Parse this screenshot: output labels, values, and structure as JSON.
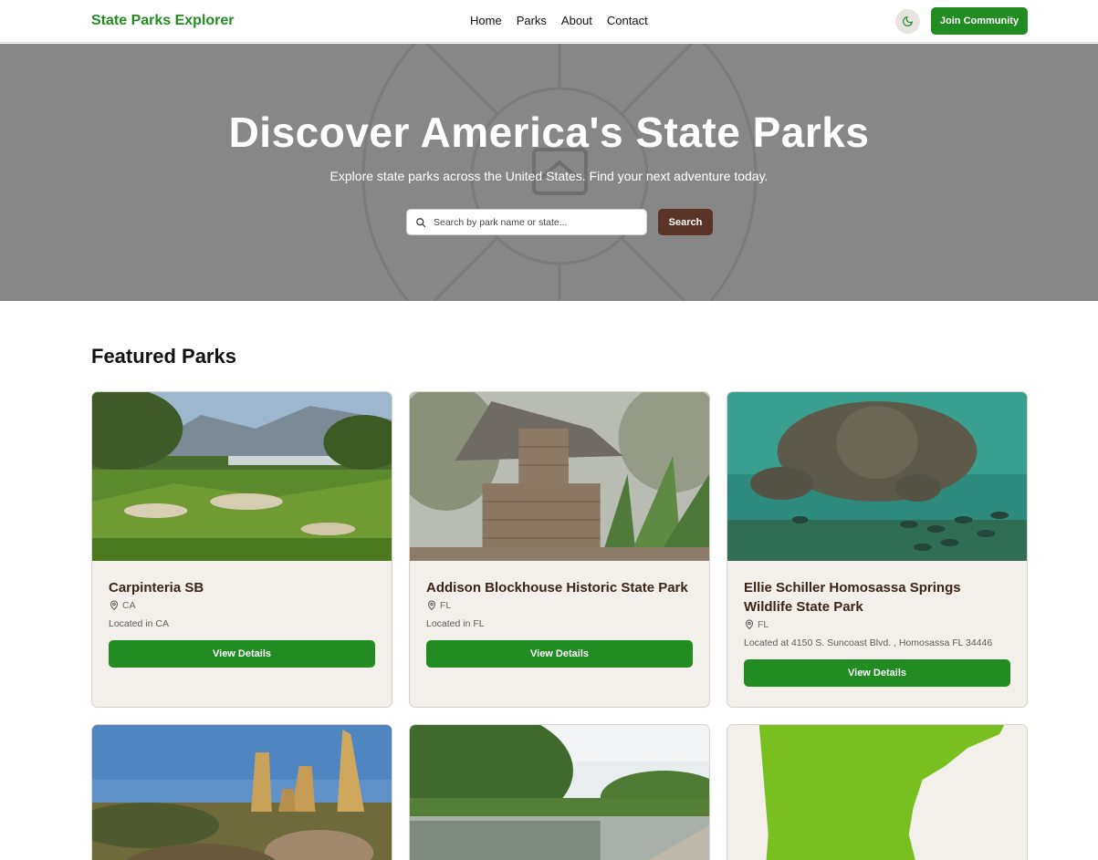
{
  "nav": {
    "brand": "State Parks Explorer",
    "links": [
      "Home",
      "Parks",
      "About",
      "Contact"
    ],
    "theme_icon": "moon-icon",
    "join_label": "Join Community"
  },
  "hero": {
    "title": "Discover America's State Parks",
    "subtitle": "Explore state parks across the United States. Find your next adventure today.",
    "search_placeholder": "Search by park name or state...",
    "search_value": "",
    "search_button": "Search"
  },
  "featured": {
    "title": "Featured Parks",
    "cards": [
      {
        "title": "Carpinteria SB",
        "state": "CA",
        "description": "Located in CA",
        "button": "View Details"
      },
      {
        "title": "Addison Blockhouse Historic State Park",
        "state": "FL",
        "description": "Located in FL",
        "button": "View Details"
      },
      {
        "title": "Ellie Schiller Homosassa Springs Wildlife State Park",
        "state": "FL",
        "description": "Located at 4150 S. Suncoast Blvd. , Homosassa FL 34446",
        "button": "View Details"
      }
    ]
  },
  "colors": {
    "brand_green": "#228b22",
    "search_brown": "#5b3427",
    "hero_gray": "#878787",
    "card_bg": "#f3f0eb"
  }
}
